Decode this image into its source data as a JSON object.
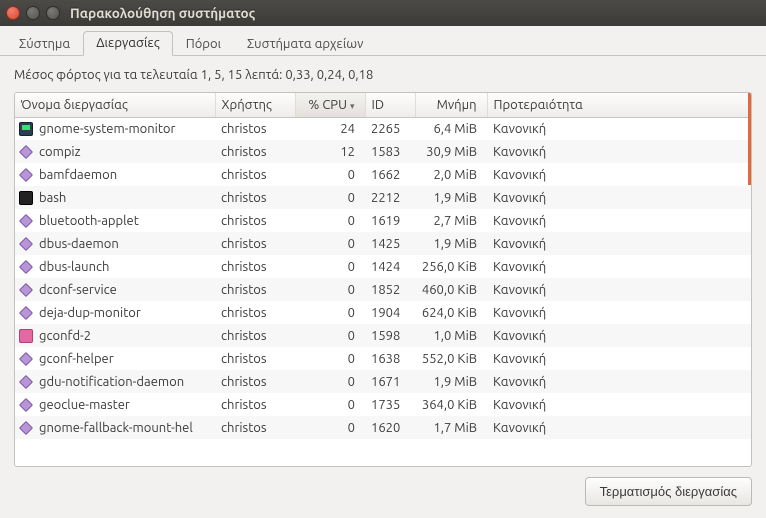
{
  "window": {
    "title": "Παρακολούθηση συστήματος"
  },
  "tabs": {
    "system": "Σύστημα",
    "processes": "Διεργασίες",
    "resources": "Πόροι",
    "filesystems": "Συστήματα αρχείων"
  },
  "loadavg_text": "Μέσος φόρτος για τα τελευταία 1, 5, 15 λεπτά: 0,33, 0,24, 0,18",
  "columns": {
    "name": "Όνομα διεργασίας",
    "user": "Χρήστης",
    "cpu": "% CPU",
    "id": "ID",
    "mem": "Μνήμη",
    "priority": "Προτεραιότητα"
  },
  "sort_column": "cpu",
  "sort_dir": "desc",
  "processes": [
    {
      "icon": "monitor",
      "name": "gnome-system-monitor",
      "user": "christos",
      "cpu": "24",
      "id": "2265",
      "mem": "6,4 MiB",
      "priority": "Κανονική"
    },
    {
      "icon": "diamond",
      "name": "compiz",
      "user": "christos",
      "cpu": "12",
      "id": "1583",
      "mem": "30,9 MiB",
      "priority": "Κανονική"
    },
    {
      "icon": "diamond",
      "name": "bamfdaemon",
      "user": "christos",
      "cpu": "0",
      "id": "1662",
      "mem": "2,0 MiB",
      "priority": "Κανονική"
    },
    {
      "icon": "term",
      "name": "bash",
      "user": "christos",
      "cpu": "0",
      "id": "2212",
      "mem": "1,9 MiB",
      "priority": "Κανονική"
    },
    {
      "icon": "diamond",
      "name": "bluetooth-applet",
      "user": "christos",
      "cpu": "0",
      "id": "1619",
      "mem": "2,7 MiB",
      "priority": "Κανονική"
    },
    {
      "icon": "diamond",
      "name": "dbus-daemon",
      "user": "christos",
      "cpu": "0",
      "id": "1425",
      "mem": "1,9 MiB",
      "priority": "Κανονική"
    },
    {
      "icon": "diamond",
      "name": "dbus-launch",
      "user": "christos",
      "cpu": "0",
      "id": "1424",
      "mem": "256,0 KiB",
      "priority": "Κανονική"
    },
    {
      "icon": "diamond",
      "name": "dconf-service",
      "user": "christos",
      "cpu": "0",
      "id": "1852",
      "mem": "460,0 KiB",
      "priority": "Κανονική"
    },
    {
      "icon": "diamond",
      "name": "deja-dup-monitor",
      "user": "christos",
      "cpu": "0",
      "id": "1904",
      "mem": "624,0 KiB",
      "priority": "Κανονική"
    },
    {
      "icon": "pink",
      "name": "gconfd-2",
      "user": "christos",
      "cpu": "0",
      "id": "1598",
      "mem": "1,0 MiB",
      "priority": "Κανονική"
    },
    {
      "icon": "diamond",
      "name": "gconf-helper",
      "user": "christos",
      "cpu": "0",
      "id": "1638",
      "mem": "552,0 KiB",
      "priority": "Κανονική"
    },
    {
      "icon": "diamond",
      "name": "gdu-notification-daemon",
      "user": "christos",
      "cpu": "0",
      "id": "1671",
      "mem": "1,9 MiB",
      "priority": "Κανονική"
    },
    {
      "icon": "diamond",
      "name": "geoclue-master",
      "user": "christos",
      "cpu": "0",
      "id": "1735",
      "mem": "364,0 KiB",
      "priority": "Κανονική"
    },
    {
      "icon": "diamond",
      "name": "gnome-fallback-mount-hel",
      "user": "christos",
      "cpu": "0",
      "id": "1620",
      "mem": "1,7 MiB",
      "priority": "Κανονική"
    }
  ],
  "footer": {
    "end_process": "Τερματισμός διεργασίας"
  }
}
